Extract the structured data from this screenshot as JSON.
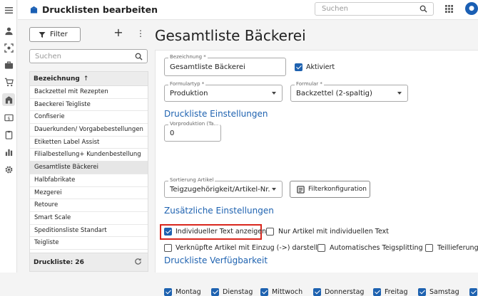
{
  "rail": {
    "icons": [
      "menu-icon",
      "person-icon",
      "scan-icon",
      "briefcase-icon",
      "cart-icon",
      "bakery-icon",
      "cash-icon",
      "clipboard-icon",
      "bar-chart-icon",
      "settings-icon"
    ]
  },
  "header": {
    "title": "Drucklisten bearbeiten",
    "search_placeholder": "Suchen"
  },
  "sidebar": {
    "filter_label": "Filter",
    "search_placeholder": "Suchen",
    "column_header": "Bezeichnung",
    "sort_indicator": "↑",
    "items": [
      "Backzettel mit Rezepten",
      "Baeckerei Teigliste",
      "Confiserie",
      "Dauerkunden/ Vorgabebestellungen",
      "Etiketten Label Assist",
      "Filialbestellung+ Kundenbestellung",
      "Gesamtliste Bäckerei",
      "Halbfabrikate",
      "Mezgerei",
      "Retoure",
      "Smart Scale",
      "Speditionsliste Standart",
      "Teigliste"
    ],
    "selected_index": 6,
    "footer_count": "Druckliste: 26"
  },
  "main": {
    "page_title": "Gesamtliste Bäckerei",
    "bezeichnung": {
      "label": "Bezeichnung *",
      "value": "Gesamtliste Bäckerei"
    },
    "aktiviert": {
      "label": "Aktiviert",
      "checked": true
    },
    "formulartyp": {
      "label": "Formulartyp *",
      "value": "Produktion"
    },
    "formular": {
      "label": "Formular *",
      "value": "Backzettel (2-spaltig)"
    },
    "section_druckliste": "Druckliste Einstellungen",
    "vorproduktion": {
      "label": "Vorproduktion (Ta...",
      "value": "0"
    },
    "sortierung": {
      "label": "Sortierung Artikel",
      "value": "Teigzugehörigkeit/Artikel-Nr."
    },
    "filterkonfiguration_label": "Filterkonfiguration",
    "section_zusaetzlich": "Zusätzliche Einstellungen",
    "options": {
      "individueller_text": {
        "label": "Individueller Text anzeigen",
        "checked": true
      },
      "nur_artikel": {
        "label": "Nur Artikel mit individuellen Text",
        "checked": false
      },
      "verknuepfte": {
        "label": "Verknüpfte Artikel mit Einzug (->) darstellen",
        "checked": false
      },
      "teigsplitting": {
        "label": "Automatisches Teigsplitting",
        "checked": false
      },
      "teillieferungen": {
        "label": "Teillieferunge",
        "checked": false
      }
    },
    "section_verfuegbarkeit": "Druckliste Verfügbarkeit",
    "days": [
      {
        "label": "Montag",
        "checked": true
      },
      {
        "label": "Dienstag",
        "checked": true
      },
      {
        "label": "Mittwoch",
        "checked": true
      },
      {
        "label": "Donnerstag",
        "checked": true
      },
      {
        "label": "Freitag",
        "checked": true
      },
      {
        "label": "Samstag",
        "checked": true
      }
    ]
  },
  "colors": {
    "accent": "#1e62b0",
    "highlight": "#d9261c"
  }
}
